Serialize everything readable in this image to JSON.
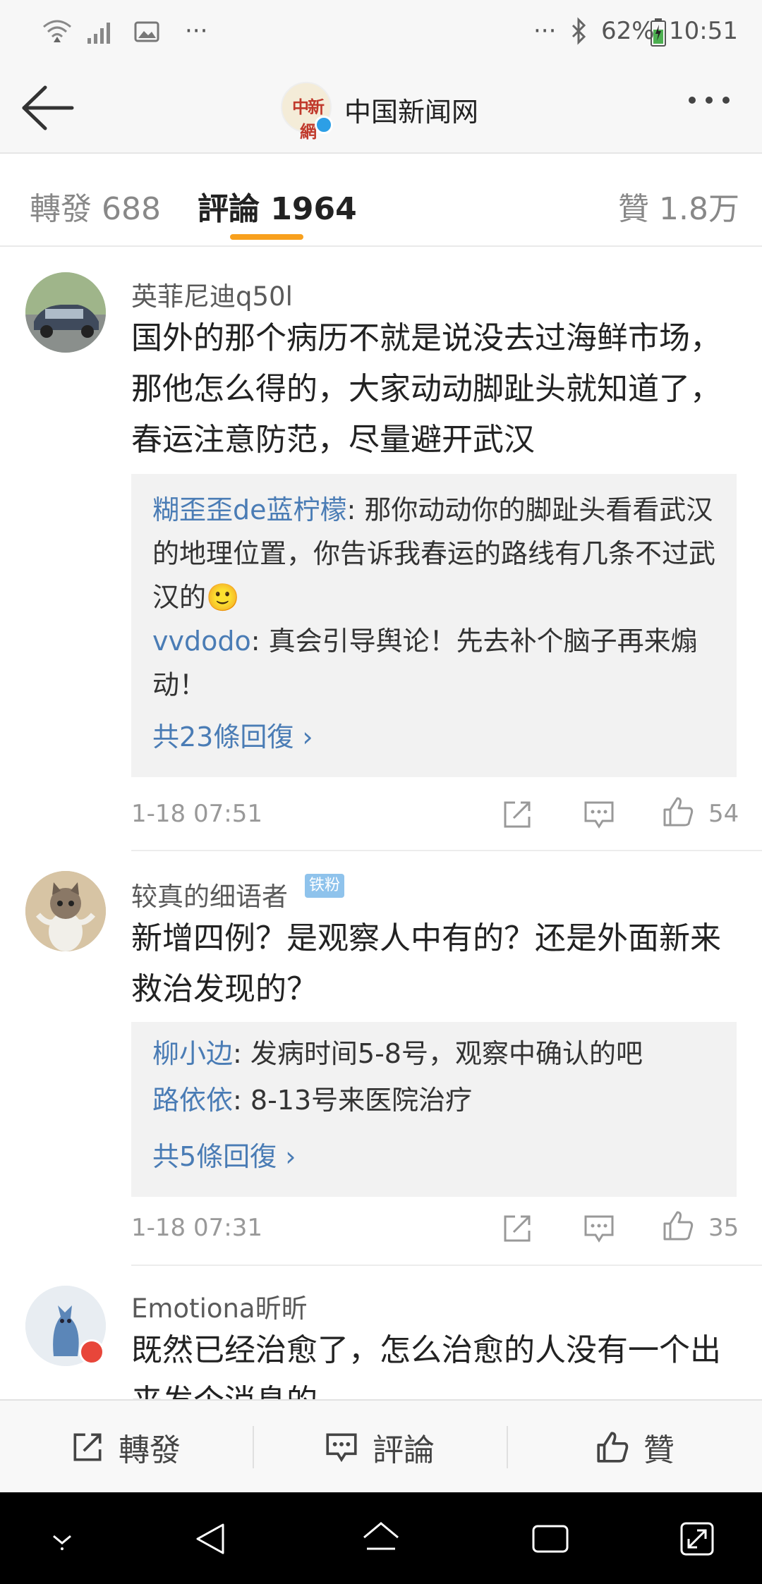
{
  "status_bar": {
    "dots_left": "···",
    "dots_right": "···",
    "battery": "62%",
    "time": "10:51"
  },
  "header": {
    "logo_text": "中新網",
    "title": "中国新闻网"
  },
  "tabs": {
    "repost": "轉發 688",
    "comment": "評論 1964",
    "like": "贊 1.8万"
  },
  "comments": [
    {
      "username": "英菲尼迪q50l",
      "text": "国外的那个病历不就是说没去过海鲜市场，那他怎么得的，大家动动脚趾头就知道了，春运注意防范，尽量避开武汉",
      "replies": [
        {
          "name": "糊歪歪de蓝柠檬",
          "text": ": 那你动动你的脚趾头看看武汉的地理位置，你告诉我春运的路线有几条不过武汉的🙂"
        },
        {
          "name": "vvdodo",
          "text": ": 真会引导舆论！先去补个脑子再来煽动！"
        }
      ],
      "more_replies": "共23條回復 ›",
      "time": "1-18 07:51",
      "likes": "54"
    },
    {
      "username": "较真的细语者",
      "badge": "铁粉",
      "text": "新增四例？是观察人中有的？还是外面新来救治发现的？",
      "replies": [
        {
          "name": "柳小边",
          "text": ": 发病时间5-8号，观察中确认的吧"
        },
        {
          "name": "路依依",
          "text": ": 8-13号来医院治疗"
        }
      ],
      "more_replies": "共5條回復 ›",
      "time": "1-18 07:31",
      "likes": "35"
    },
    {
      "username": "Emotiona昕昕",
      "text": "既然已经治愈了，怎么治愈的人没有一个出来发个消息的。"
    }
  ],
  "action_bar": {
    "repost": "轉發",
    "comment": "評論",
    "like": "贊"
  },
  "colors": {
    "accent": "#f8a01d",
    "link": "#4a7cb5",
    "verified": "#2c9fe6"
  }
}
